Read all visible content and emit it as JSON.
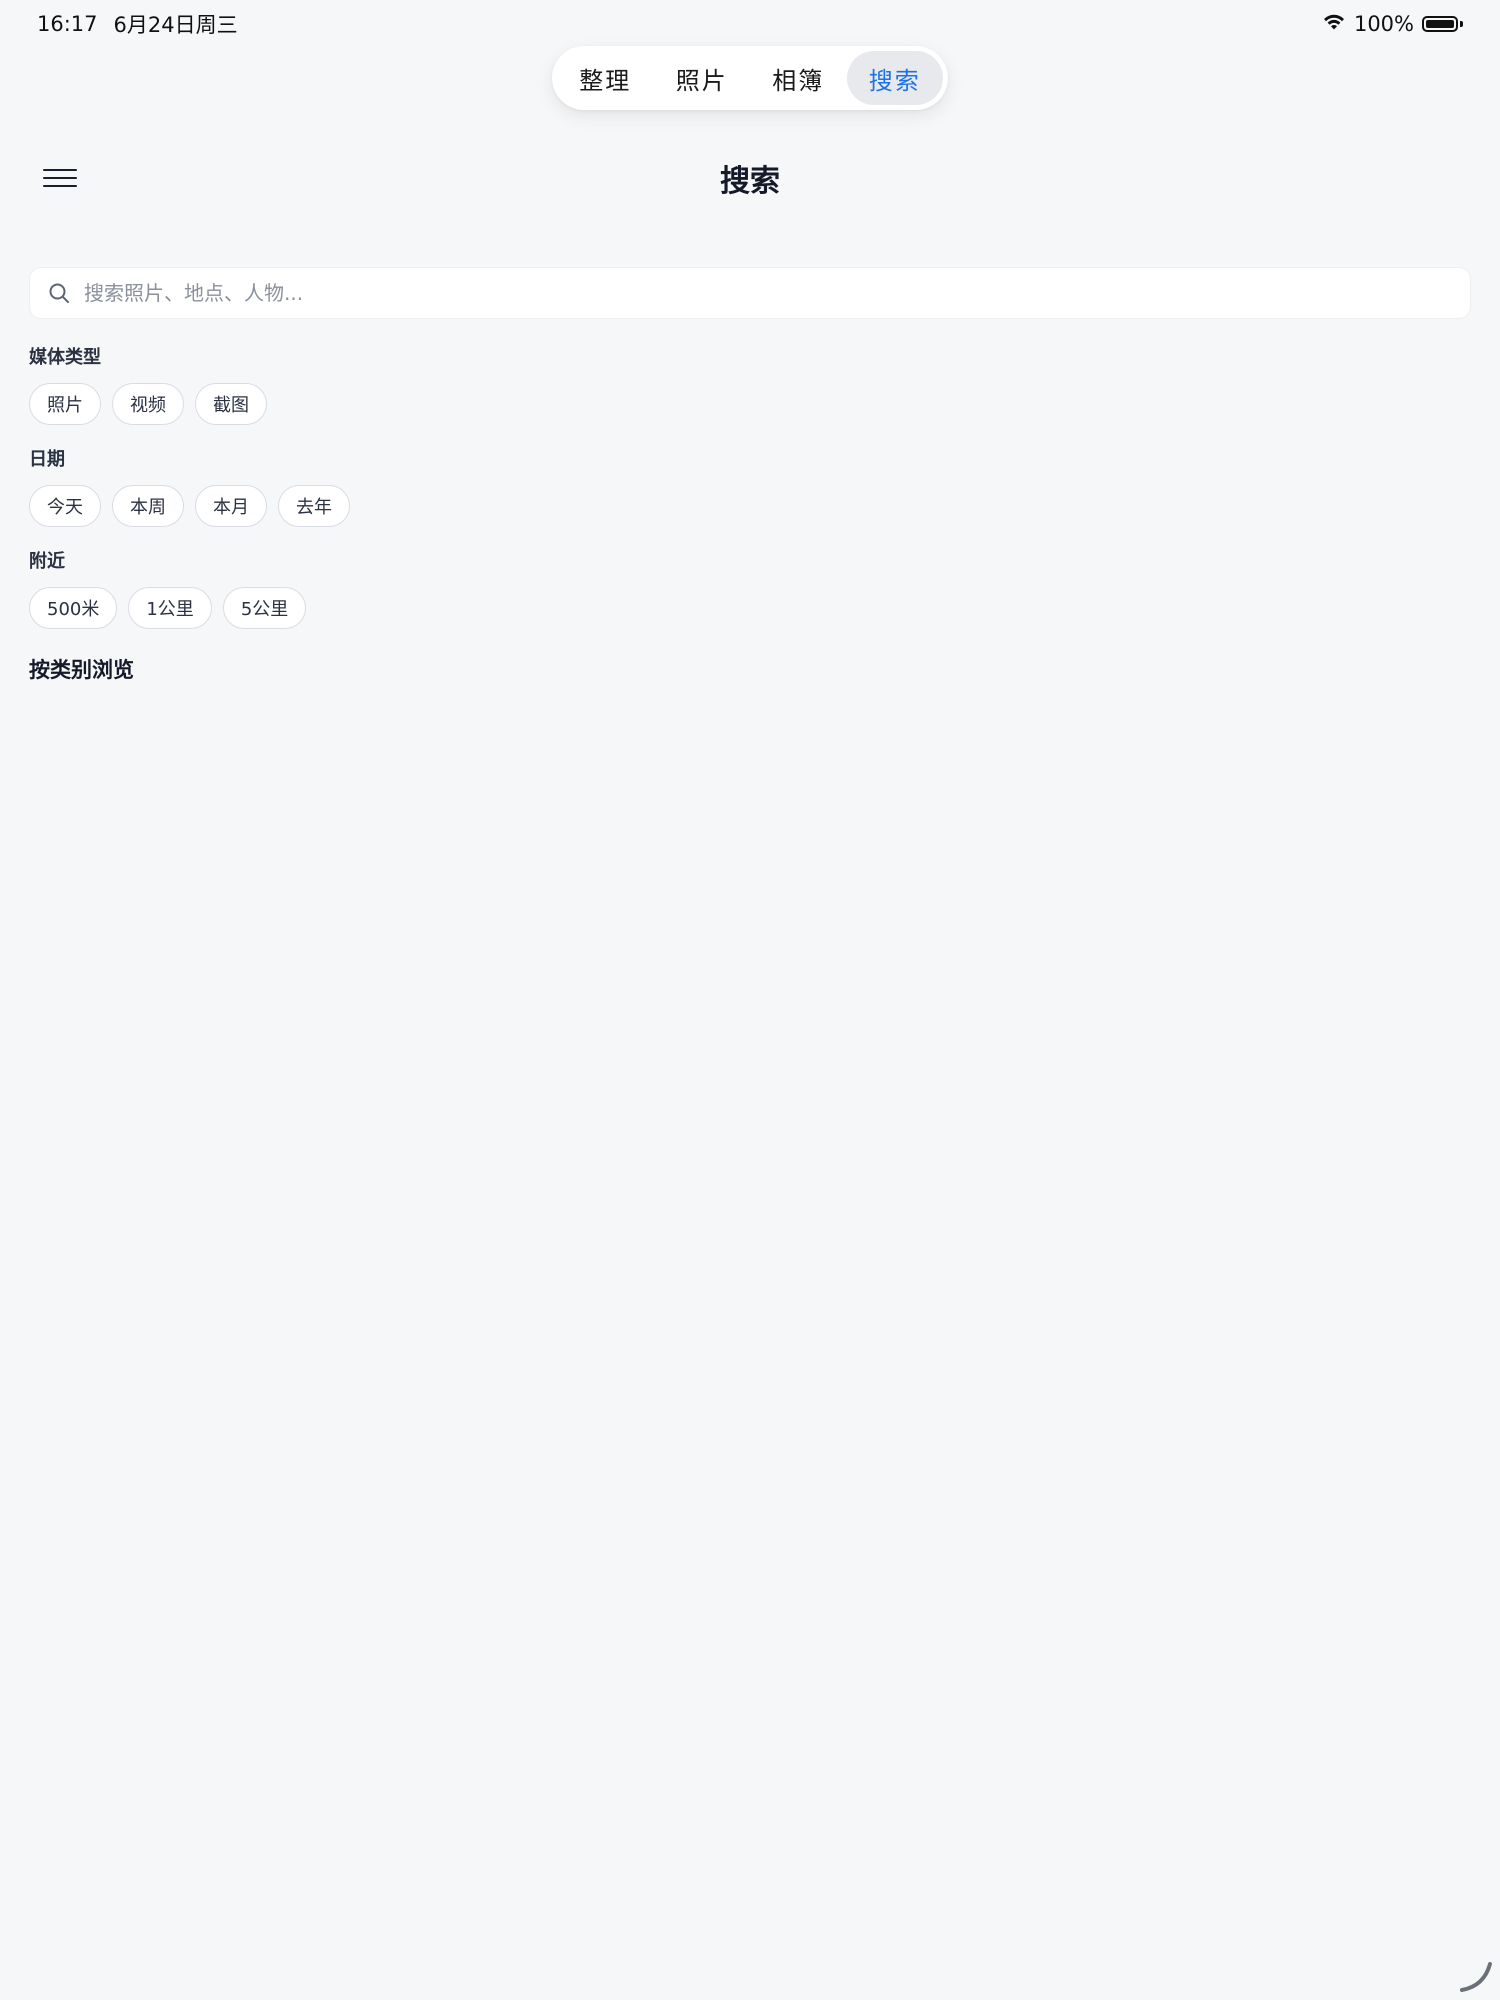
{
  "status_bar": {
    "time": "16:17",
    "date": "6月24日周三",
    "battery_text": "100%",
    "battery_level": 1.0
  },
  "tabs": [
    {
      "label": "整理",
      "active": false
    },
    {
      "label": "照片",
      "active": false
    },
    {
      "label": "相簿",
      "active": false
    },
    {
      "label": "搜索",
      "active": true
    }
  ],
  "header": {
    "title": "搜索",
    "menu_icon": "hamburger-menu-icon"
  },
  "search": {
    "placeholder": "搜索照片、地点、人物...",
    "value": "",
    "icon": "search-icon"
  },
  "filters": {
    "media_type": {
      "label": "媒体类型",
      "chips": [
        "照片",
        "视频",
        "截图"
      ]
    },
    "date": {
      "label": "日期",
      "chips": [
        "今天",
        "本周",
        "本月",
        "去年"
      ]
    },
    "nearby": {
      "label": "附近",
      "chips": [
        "500米",
        "1公里",
        "5公里"
      ]
    }
  },
  "browse": {
    "title": "按类别浏览"
  },
  "colors": {
    "background": "#f6f7f9",
    "accent": "#1a73e8",
    "chip_border": "#d9dce2"
  }
}
